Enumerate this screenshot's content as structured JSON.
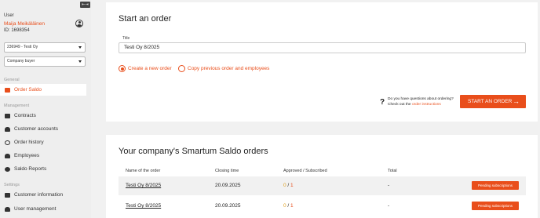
{
  "sidebar": {
    "user_label": "User",
    "user_name": "Maija Meikäläinen",
    "user_id": "ID: 1698354",
    "company_select": "236949 - Testi Oy",
    "role_select": "Company buyer",
    "sections": {
      "general": "General",
      "management": "Management",
      "settings": "Settings"
    },
    "items": {
      "order_saldo": "Order Saldo",
      "contracts": "Contracts",
      "customer_accounts": "Customer accounts",
      "order_history": "Order history",
      "employees": "Employees",
      "saldo_reports": "Saldo Reports",
      "customer_information": "Customer information",
      "user_management": "User management"
    }
  },
  "start_order": {
    "heading": "Start an order",
    "title_label": "Title",
    "title_value": "Testi Oy 8/2025",
    "option_new": "Create a new order",
    "option_copy": "Copy previous order and employees",
    "help_question": "Do you have questions about ordering?",
    "help_prefix": "Check out the",
    "help_link": "order instructions",
    "cta_label": "START AN ORDER",
    "cta_arrow": "→"
  },
  "orders": {
    "heading": "Your company's Smartum Saldo orders",
    "columns": {
      "name": "Name of the order",
      "closing": "Closing time",
      "approved": "Approved / Subscribed",
      "total": "Total"
    },
    "rows": [
      {
        "name": "Testi Oy 8/2025",
        "closing": "20.09.2025",
        "approved": "0",
        "subscribed": "1",
        "total": "-",
        "status": "Pending subscriptions"
      },
      {
        "name": "Testi Oy 8/2025",
        "closing": "20.09.2025",
        "approved": "0",
        "subscribed": "1",
        "total": "-",
        "status": "Pending subscriptions"
      }
    ]
  },
  "icons": {
    "collapse": "collapse-sidebar-icon",
    "avatar": "user-avatar-icon",
    "help": "question-mark-icon"
  },
  "colors": {
    "accent": "#e94e1b",
    "approved": "#e0a020"
  }
}
